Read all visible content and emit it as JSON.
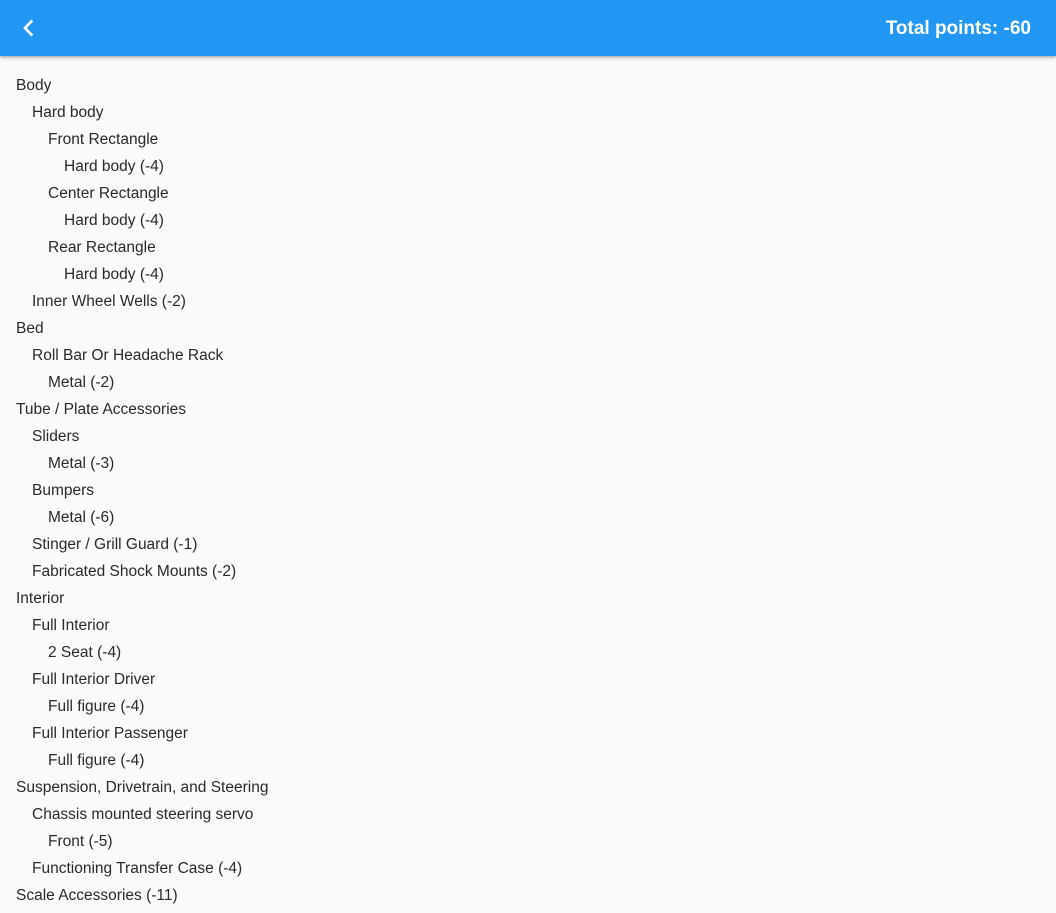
{
  "header": {
    "back_icon": "chevron-left-icon",
    "total_label": "Total points: -60",
    "background_color": "#2196f3"
  },
  "tree": [
    {
      "level": 0,
      "label": "Body"
    },
    {
      "level": 1,
      "label": "Hard body"
    },
    {
      "level": 2,
      "label": "Front Rectangle"
    },
    {
      "level": 3,
      "label": "Hard body (-4)"
    },
    {
      "level": 2,
      "label": "Center Rectangle"
    },
    {
      "level": 3,
      "label": "Hard body (-4)"
    },
    {
      "level": 2,
      "label": "Rear Rectangle"
    },
    {
      "level": 3,
      "label": "Hard body (-4)"
    },
    {
      "level": 1,
      "label": "Inner Wheel Wells (-2)"
    },
    {
      "level": 0,
      "label": "Bed"
    },
    {
      "level": 1,
      "label": "Roll Bar Or Headache Rack"
    },
    {
      "level": 2,
      "label": "Metal (-2)"
    },
    {
      "level": 0,
      "label": "Tube / Plate Accessories"
    },
    {
      "level": 1,
      "label": "Sliders"
    },
    {
      "level": 2,
      "label": "Metal (-3)"
    },
    {
      "level": 1,
      "label": "Bumpers"
    },
    {
      "level": 2,
      "label": "Metal (-6)"
    },
    {
      "level": 1,
      "label": "Stinger / Grill Guard (-1)"
    },
    {
      "level": 1,
      "label": "Fabricated Shock Mounts (-2)"
    },
    {
      "level": 0,
      "label": "Interior"
    },
    {
      "level": 1,
      "label": "Full Interior"
    },
    {
      "level": 2,
      "label": "2 Seat (-4)"
    },
    {
      "level": 1,
      "label": "Full Interior Driver"
    },
    {
      "level": 2,
      "label": "Full figure (-4)"
    },
    {
      "level": 1,
      "label": "Full Interior Passenger"
    },
    {
      "level": 2,
      "label": "Full figure (-4)"
    },
    {
      "level": 0,
      "label": "Suspension, Drivetrain, and Steering"
    },
    {
      "level": 1,
      "label": "Chassis mounted steering servo"
    },
    {
      "level": 2,
      "label": "Front (-5)"
    },
    {
      "level": 1,
      "label": "Functioning Transfer Case (-4)"
    },
    {
      "level": 0,
      "label": "Scale Accessories (-11)"
    }
  ]
}
